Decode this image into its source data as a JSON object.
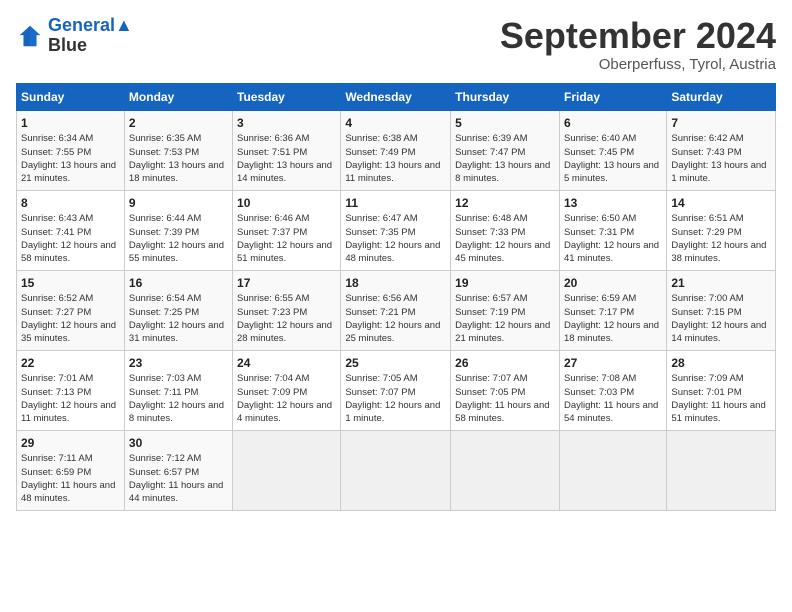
{
  "header": {
    "logo_line1": "General",
    "logo_line2": "Blue",
    "month": "September 2024",
    "location": "Oberperfuss, Tyrol, Austria"
  },
  "days_of_week": [
    "Sunday",
    "Monday",
    "Tuesday",
    "Wednesday",
    "Thursday",
    "Friday",
    "Saturday"
  ],
  "weeks": [
    [
      {
        "day": "1",
        "info": "Sunrise: 6:34 AM\nSunset: 7:55 PM\nDaylight: 13 hours\nand 21 minutes."
      },
      {
        "day": "2",
        "info": "Sunrise: 6:35 AM\nSunset: 7:53 PM\nDaylight: 13 hours\nand 18 minutes."
      },
      {
        "day": "3",
        "info": "Sunrise: 6:36 AM\nSunset: 7:51 PM\nDaylight: 13 hours\nand 14 minutes."
      },
      {
        "day": "4",
        "info": "Sunrise: 6:38 AM\nSunset: 7:49 PM\nDaylight: 13 hours\nand 11 minutes."
      },
      {
        "day": "5",
        "info": "Sunrise: 6:39 AM\nSunset: 7:47 PM\nDaylight: 13 hours\nand 8 minutes."
      },
      {
        "day": "6",
        "info": "Sunrise: 6:40 AM\nSunset: 7:45 PM\nDaylight: 13 hours\nand 5 minutes."
      },
      {
        "day": "7",
        "info": "Sunrise: 6:42 AM\nSunset: 7:43 PM\nDaylight: 13 hours\nand 1 minute."
      }
    ],
    [
      {
        "day": "8",
        "info": "Sunrise: 6:43 AM\nSunset: 7:41 PM\nDaylight: 12 hours\nand 58 minutes."
      },
      {
        "day": "9",
        "info": "Sunrise: 6:44 AM\nSunset: 7:39 PM\nDaylight: 12 hours\nand 55 minutes."
      },
      {
        "day": "10",
        "info": "Sunrise: 6:46 AM\nSunset: 7:37 PM\nDaylight: 12 hours\nand 51 minutes."
      },
      {
        "day": "11",
        "info": "Sunrise: 6:47 AM\nSunset: 7:35 PM\nDaylight: 12 hours\nand 48 minutes."
      },
      {
        "day": "12",
        "info": "Sunrise: 6:48 AM\nSunset: 7:33 PM\nDaylight: 12 hours\nand 45 minutes."
      },
      {
        "day": "13",
        "info": "Sunrise: 6:50 AM\nSunset: 7:31 PM\nDaylight: 12 hours\nand 41 minutes."
      },
      {
        "day": "14",
        "info": "Sunrise: 6:51 AM\nSunset: 7:29 PM\nDaylight: 12 hours\nand 38 minutes."
      }
    ],
    [
      {
        "day": "15",
        "info": "Sunrise: 6:52 AM\nSunset: 7:27 PM\nDaylight: 12 hours\nand 35 minutes."
      },
      {
        "day": "16",
        "info": "Sunrise: 6:54 AM\nSunset: 7:25 PM\nDaylight: 12 hours\nand 31 minutes."
      },
      {
        "day": "17",
        "info": "Sunrise: 6:55 AM\nSunset: 7:23 PM\nDaylight: 12 hours\nand 28 minutes."
      },
      {
        "day": "18",
        "info": "Sunrise: 6:56 AM\nSunset: 7:21 PM\nDaylight: 12 hours\nand 25 minutes."
      },
      {
        "day": "19",
        "info": "Sunrise: 6:57 AM\nSunset: 7:19 PM\nDaylight: 12 hours\nand 21 minutes."
      },
      {
        "day": "20",
        "info": "Sunrise: 6:59 AM\nSunset: 7:17 PM\nDaylight: 12 hours\nand 18 minutes."
      },
      {
        "day": "21",
        "info": "Sunrise: 7:00 AM\nSunset: 7:15 PM\nDaylight: 12 hours\nand 14 minutes."
      }
    ],
    [
      {
        "day": "22",
        "info": "Sunrise: 7:01 AM\nSunset: 7:13 PM\nDaylight: 12 hours\nand 11 minutes."
      },
      {
        "day": "23",
        "info": "Sunrise: 7:03 AM\nSunset: 7:11 PM\nDaylight: 12 hours\nand 8 minutes."
      },
      {
        "day": "24",
        "info": "Sunrise: 7:04 AM\nSunset: 7:09 PM\nDaylight: 12 hours\nand 4 minutes."
      },
      {
        "day": "25",
        "info": "Sunrise: 7:05 AM\nSunset: 7:07 PM\nDaylight: 12 hours\nand 1 minute."
      },
      {
        "day": "26",
        "info": "Sunrise: 7:07 AM\nSunset: 7:05 PM\nDaylight: 11 hours\nand 58 minutes."
      },
      {
        "day": "27",
        "info": "Sunrise: 7:08 AM\nSunset: 7:03 PM\nDaylight: 11 hours\nand 54 minutes."
      },
      {
        "day": "28",
        "info": "Sunrise: 7:09 AM\nSunset: 7:01 PM\nDaylight: 11 hours\nand 51 minutes."
      }
    ],
    [
      {
        "day": "29",
        "info": "Sunrise: 7:11 AM\nSunset: 6:59 PM\nDaylight: 11 hours\nand 48 minutes."
      },
      {
        "day": "30",
        "info": "Sunrise: 7:12 AM\nSunset: 6:57 PM\nDaylight: 11 hours\nand 44 minutes."
      },
      {
        "day": "",
        "info": ""
      },
      {
        "day": "",
        "info": ""
      },
      {
        "day": "",
        "info": ""
      },
      {
        "day": "",
        "info": ""
      },
      {
        "day": "",
        "info": ""
      }
    ]
  ]
}
